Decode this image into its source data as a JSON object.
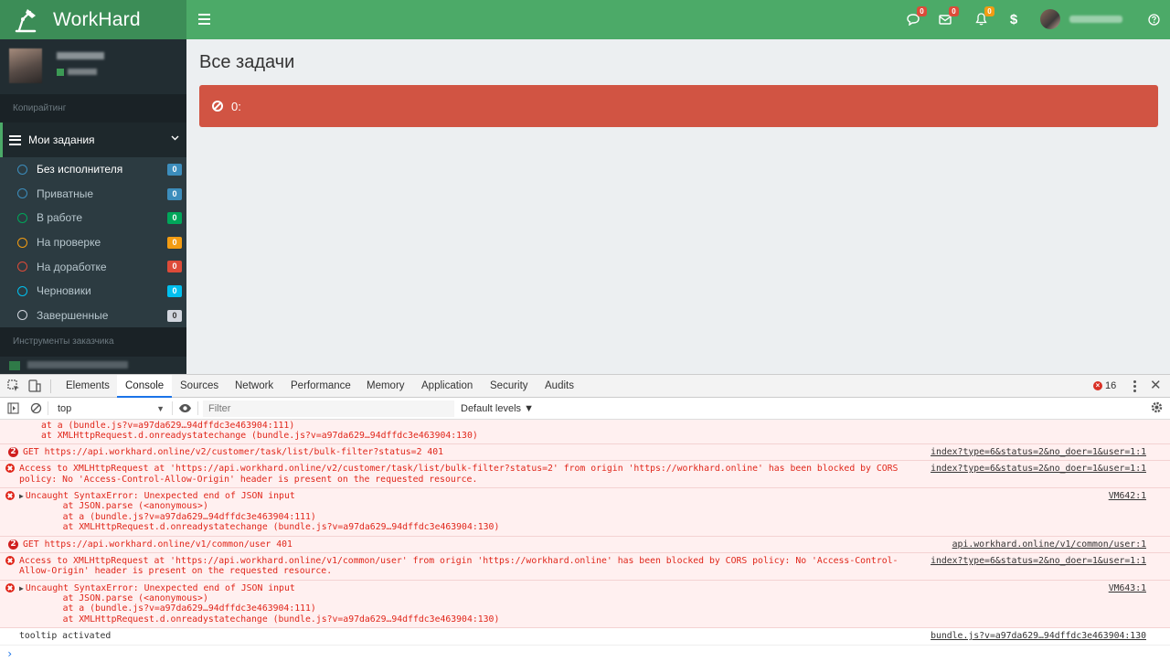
{
  "app": {
    "brand": "WorkHard",
    "page_title": "Все задачи",
    "alert_text": "0:",
    "colors": {
      "brand_green": "#4caa68",
      "brand_dark": "#3c8d57",
      "sidebar_bg": "#222d32",
      "alert_red": "#d15443"
    },
    "topbar": {
      "icons": [
        {
          "name": "chat-icon",
          "badge": "0",
          "badge_color": "red"
        },
        {
          "name": "envelope-icon",
          "badge": "0",
          "badge_color": "red"
        },
        {
          "name": "bell-icon",
          "badge": "0",
          "badge_color": "orange"
        },
        {
          "name": "dollar-icon",
          "glyph": "$"
        }
      ],
      "help_icon": "question-circle-icon"
    },
    "sidebar": {
      "header": "Копирайтинг",
      "section_label": "Мои задания",
      "items": [
        {
          "label": "Без исполнителя",
          "count": "0",
          "color": "#3c8dbc",
          "badge_color": "#3c8dbc"
        },
        {
          "label": "Приватные",
          "count": "0",
          "color": "#3c8dbc",
          "badge_color": "#3c8dbc"
        },
        {
          "label": "В работе",
          "count": "0",
          "color": "#00a65a",
          "badge_color": "#00a65a"
        },
        {
          "label": "На проверке",
          "count": "0",
          "color": "#f39c12",
          "badge_color": "#f39c12"
        },
        {
          "label": "На доработке",
          "count": "0",
          "color": "#dd4b39",
          "badge_color": "#dd4b39"
        },
        {
          "label": "Черновики",
          "count": "0",
          "color": "#00c0ef",
          "badge_color": "#00c0ef"
        },
        {
          "label": "Завершенные",
          "count": "0",
          "color": "#d2d6de",
          "badge_color": "#d2d6de"
        }
      ],
      "header2": "Инструменты заказчика"
    }
  },
  "devtools": {
    "tabs": [
      "Elements",
      "Console",
      "Sources",
      "Network",
      "Performance",
      "Memory",
      "Application",
      "Security",
      "Audits"
    ],
    "active_tab": "Console",
    "error_count": "16",
    "context": "top",
    "filter_placeholder": "Filter",
    "levels": "Default levels ▼",
    "console_lines": [
      {
        "type": "err-cont",
        "rows": [
          "at a (bundle.js?v=a97da629…94dffdc3e463904:111)",
          "at XMLHttpRequest.d.onreadystatechange (bundle.js?v=a97da629…94dffdc3e463904:130)"
        ]
      },
      {
        "type": "get",
        "count": "2",
        "rows": [
          "GET https://api.workhard.online/v2/customer/task/list/bulk-filter?status=2 401"
        ],
        "source": "index?type=6&status=2&no_doer=1&user=1:1"
      },
      {
        "type": "err",
        "rows": [
          "Access to XMLHttpRequest at 'https://api.workhard.online/v2/customer/task/list/bulk-filter?status=2' from origin 'https://workhard.online' has been blocked by CORS",
          "policy: No 'Access-Control-Allow-Origin' header is present on the requested resource."
        ],
        "source": "index?type=6&status=2&no_doer=1&user=1:1"
      },
      {
        "type": "err",
        "expand": true,
        "rows": [
          "Uncaught SyntaxError: Unexpected end of JSON input",
          "    at JSON.parse (<anonymous>)",
          "    at a (bundle.js?v=a97da629…94dffdc3e463904:111)",
          "    at XMLHttpRequest.d.onreadystatechange (bundle.js?v=a97da629…94dffdc3e463904:130)"
        ],
        "source": "VM642:1"
      },
      {
        "type": "get",
        "count": "2",
        "rows": [
          "GET https://api.workhard.online/v1/common/user 401"
        ],
        "source": "api.workhard.online/v1/common/user:1"
      },
      {
        "type": "err",
        "rows": [
          "Access to XMLHttpRequest at 'https://api.workhard.online/v1/common/user' from origin 'https://workhard.online' has been blocked by CORS policy: No 'Access-Control-",
          "Allow-Origin' header is present on the requested resource."
        ],
        "source": "index?type=6&status=2&no_doer=1&user=1:1"
      },
      {
        "type": "err",
        "expand": true,
        "rows": [
          "Uncaught SyntaxError: Unexpected end of JSON input",
          "    at JSON.parse (<anonymous>)",
          "    at a (bundle.js?v=a97da629…94dffdc3e463904:111)",
          "    at XMLHttpRequest.d.onreadystatechange (bundle.js?v=a97da629…94dffdc3e463904:130)"
        ],
        "source": "VM643:1"
      },
      {
        "type": "plain",
        "rows": [
          "tooltip activated"
        ],
        "source": "bundle.js?v=a97da629…94dffdc3e463904:130"
      }
    ]
  }
}
